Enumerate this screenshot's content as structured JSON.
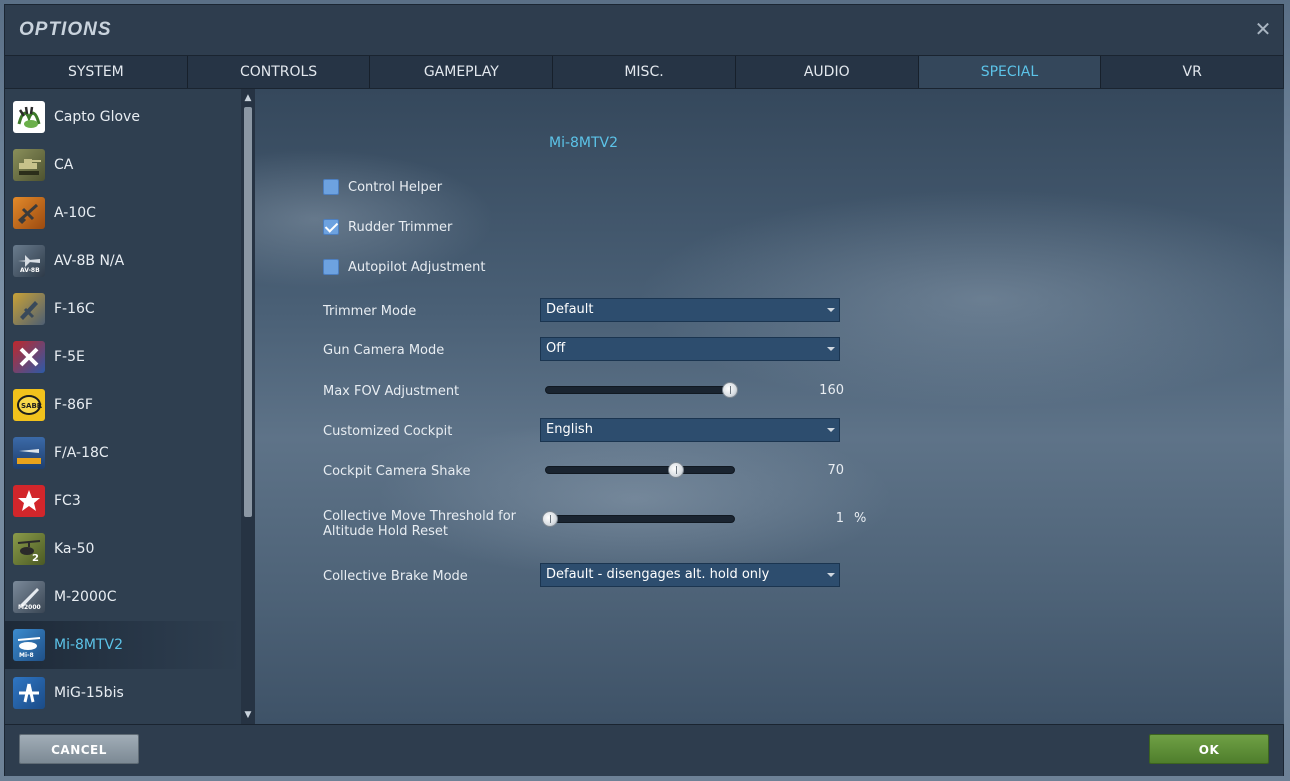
{
  "window": {
    "title": "OPTIONS",
    "close_symbol": "✕"
  },
  "tabs": [
    {
      "label": "SYSTEM",
      "active": false
    },
    {
      "label": "CONTROLS",
      "active": false
    },
    {
      "label": "GAMEPLAY",
      "active": false
    },
    {
      "label": "MISC.",
      "active": false
    },
    {
      "label": "AUDIO",
      "active": false
    },
    {
      "label": "SPECIAL",
      "active": true
    },
    {
      "label": "VR",
      "active": false
    }
  ],
  "sidebar": {
    "selected_index": 11,
    "items": [
      {
        "label": "Capto Glove",
        "icon": "capto-glove-icon"
      },
      {
        "label": "CA",
        "icon": "ca-icon"
      },
      {
        "label": "A-10C",
        "icon": "a10c-icon"
      },
      {
        "label": "AV-8B N/A",
        "icon": "av8b-icon"
      },
      {
        "label": "F-16C",
        "icon": "f16c-icon"
      },
      {
        "label": "F-5E",
        "icon": "f5e-icon"
      },
      {
        "label": "F-86F",
        "icon": "f86f-icon"
      },
      {
        "label": "F/A-18C",
        "icon": "fa18c-icon"
      },
      {
        "label": "FC3",
        "icon": "fc3-icon"
      },
      {
        "label": "Ka-50",
        "icon": "ka50-icon"
      },
      {
        "label": "M-2000C",
        "icon": "m2000c-icon"
      },
      {
        "label": "Mi-8MTV2",
        "icon": "mi8mtv2-icon"
      },
      {
        "label": "MiG-15bis",
        "icon": "mig15bis-icon"
      }
    ],
    "scroll_up": "▲",
    "scroll_down": "▼"
  },
  "main": {
    "title": "Mi-8MTV2",
    "checkboxes": [
      {
        "label": "Control Helper",
        "checked": false
      },
      {
        "label": "Rudder Trimmer",
        "checked": true
      },
      {
        "label": "Autopilot Adjustment",
        "checked": false
      }
    ],
    "trimmer_mode": {
      "label": "Trimmer Mode",
      "value": "Default"
    },
    "gun_camera_mode": {
      "label": "Gun Camera Mode",
      "value": "Off"
    },
    "max_fov": {
      "label": "Max FOV Adjustment",
      "value": "160",
      "fraction": 1.0
    },
    "customized_cockpit": {
      "label": "Customized Cockpit",
      "value": "English"
    },
    "cockpit_camera_shake": {
      "label": "Cockpit Camera Shake",
      "value": "70",
      "fraction": 0.7
    },
    "collective_threshold": {
      "label_line1": "Collective Move Threshold for",
      "label_line2": "Altitude Hold Reset",
      "value": "1",
      "unit": "%",
      "fraction": 0.0
    },
    "collective_brake_mode": {
      "label": "Collective Brake Mode",
      "value": "Default - disengages alt. hold only"
    }
  },
  "footer": {
    "cancel_label": "CANCEL",
    "ok_label": "OK"
  },
  "colors": {
    "accent": "#5cc3e8",
    "ok_button": "#5a8a35",
    "cancel_button": "#8d99a4",
    "checkbox": "#6da2e0"
  }
}
